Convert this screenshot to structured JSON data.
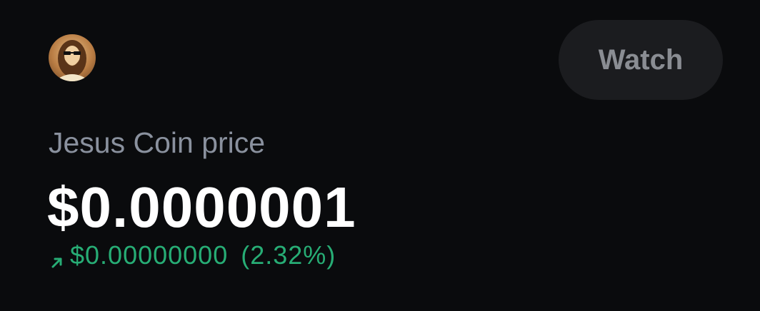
{
  "header": {
    "avatar_icon": "jesus-coin-avatar-icon",
    "watch_label": "Watch"
  },
  "price": {
    "label": "Jesus Coin price",
    "value": "$0.0000001",
    "change_icon": "arrow-up-right-icon",
    "change_amount": "$0.00000000",
    "change_percent": "(2.32%)"
  },
  "colors": {
    "background": "#0a0b0d",
    "positive": "#27ad75",
    "muted_text": "#8a919e",
    "button_bg": "#1b1c1f"
  }
}
